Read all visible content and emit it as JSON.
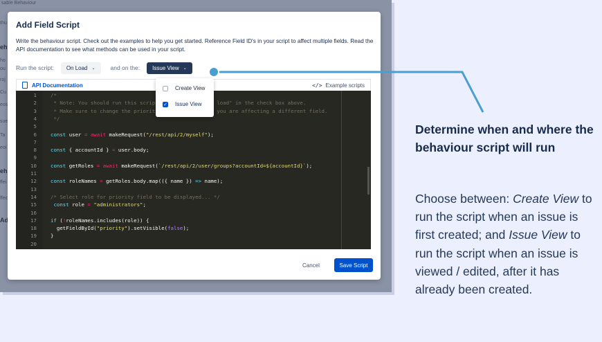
{
  "background": {
    "label_top": "sable Behaviour",
    "side_fragments": [
      "thu",
      "eh",
      "ho",
      "ou",
      "roj",
      "Cu",
      "eos",
      "sue",
      "Ta",
      "eoi",
      "eh",
      "ffei",
      "ffec",
      "Ad"
    ]
  },
  "modal": {
    "title": "Add Field Script",
    "description": "Write the behaviour script. Check out the examples to help you get started. Reference Field ID's in your script to affect multiple fields. Read the API documentation to see what methods can be used in your script.",
    "run_label": "Run the script:",
    "run_value": "On Load",
    "and_on_label": "and on the:",
    "view_value": "Issue View",
    "dropdown_options": [
      {
        "label": "Create View",
        "checked": false
      },
      {
        "label": "Issue View",
        "checked": true
      }
    ],
    "api_doc_link": "API Documentation",
    "examples_button": "Example scripts",
    "cancel_button": "Cancel",
    "save_button": "Save Script"
  },
  "code_lines": [
    {
      "n": "1",
      "html": "<span class='c-com'>/*</span>"
    },
    {
      "n": "2",
      "html": "<span class='c-com'> * Note: You should run this scrip                  n load\" in the check box above.</span>"
    },
    {
      "n": "3",
      "html": "<span class='c-com'> * Make sure to change the priority in your script if you are affecting a different field.</span>"
    },
    {
      "n": "4",
      "html": "<span class='c-com'> */</span>"
    },
    {
      "n": "5",
      "html": ""
    },
    {
      "n": "6",
      "html": "<span class='c-kw'>const</span> user <span class='c-op'>=</span> <span class='c-op'>await</span> makeRequest(<span class='c-str'>\"/rest/api/2/myself\"</span>);"
    },
    {
      "n": "7",
      "html": ""
    },
    {
      "n": "8",
      "html": "<span class='c-kw'>const</span> { accountId } <span class='c-op'>=</span> user.body;"
    },
    {
      "n": "9",
      "html": ""
    },
    {
      "n": "10",
      "html": "<span class='c-kw'>const</span> getRoles <span class='c-op'>=</span> <span class='c-op'>await</span> makeRequest(<span class='c-str'>`/rest/api/2/user/groups?accountId=${accountId}`</span>);"
    },
    {
      "n": "11",
      "html": ""
    },
    {
      "n": "12",
      "html": "<span class='c-kw'>const</span> roleNames <span class='c-op'>=</span> getRoles.body.map(({ name }) <span class='c-kw'>=&gt;</span> name);"
    },
    {
      "n": "13",
      "html": ""
    },
    {
      "n": "14",
      "html": "<span class='c-com'>/* Select role for priority field to be displayed... */</span>"
    },
    {
      "n": "15",
      "html": " <span class='c-kw'>const</span> role <span class='c-op'>=</span> <span class='c-str'>\"administrators\"</span>;"
    },
    {
      "n": "16",
      "html": ""
    },
    {
      "n": "17",
      "html": "<span class='c-kw'>if</span> (<span class='c-op'>!</span>roleNames.includes(role)) {"
    },
    {
      "n": "18",
      "html": "  getFieldById(<span class='c-str'>\"priority\"</span>).setVisible(<span class='c-num'>false</span>);"
    },
    {
      "n": "19",
      "html": "}"
    },
    {
      "n": "20",
      "html": ""
    }
  ],
  "callout": {
    "heading": "Determine when and where the behaviour script will run",
    "body_parts": [
      {
        "text": "Choose between: ",
        "italic": false
      },
      {
        "text": "Create View",
        "italic": true
      },
      {
        "text": " to run the script when an issue is first created; and ",
        "italic": false
      },
      {
        "text": "Issue View",
        "italic": true
      },
      {
        "text": " to run the script when an issue is viewed / edited, after it has already been created.",
        "italic": false
      }
    ],
    "line_color": "#4a9fd0"
  }
}
